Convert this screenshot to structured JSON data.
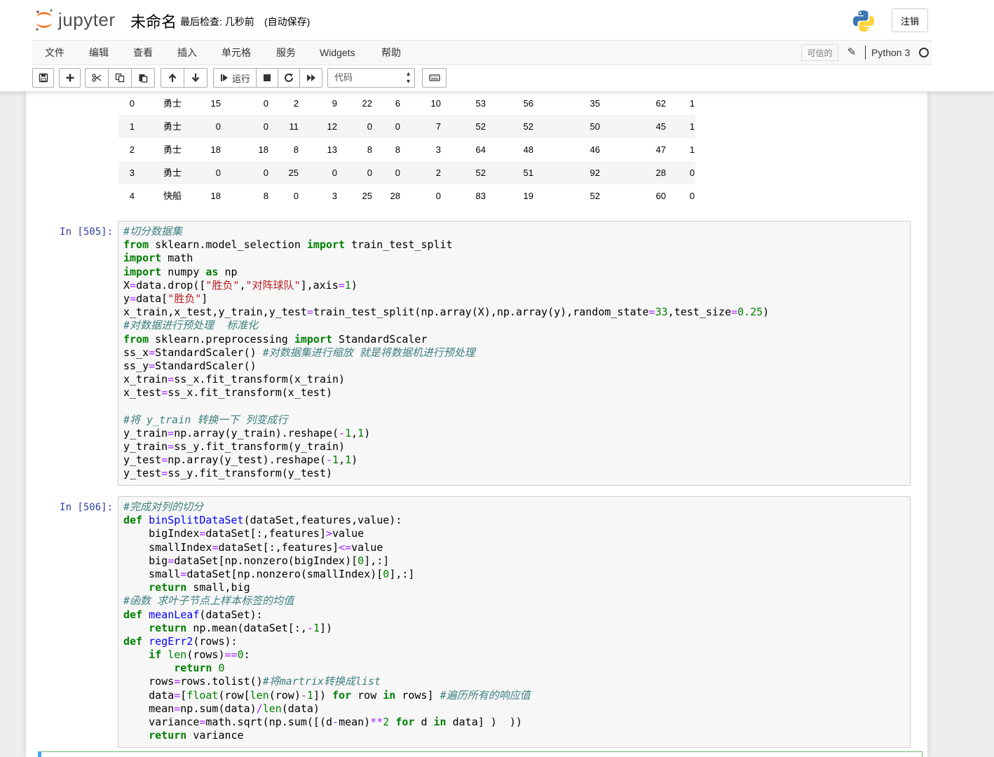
{
  "header": {
    "logo_text": "jupyter",
    "notebook_name": "未命名",
    "checkpoint": "最后检查: 几秒前",
    "autosave": "(自动保存)",
    "logout_label": "注销"
  },
  "menu": {
    "items": [
      "文件",
      "编辑",
      "查看",
      "插入",
      "单元格",
      "服务",
      "Widgets",
      "帮助"
    ],
    "trusted_label": "可信的",
    "kernel_name": "Python 3"
  },
  "toolbar": {
    "run_label": "运行",
    "cell_type": "代码"
  },
  "dataframe": {
    "rows": [
      [
        "0",
        "勇士",
        "15",
        "0",
        "2",
        "9",
        "22",
        "6",
        "10",
        "53",
        "56",
        "35",
        "62",
        "1"
      ],
      [
        "1",
        "勇士",
        "0",
        "0",
        "11",
        "12",
        "0",
        "0",
        "7",
        "52",
        "52",
        "50",
        "45",
        "1"
      ],
      [
        "2",
        "勇士",
        "18",
        "18",
        "8",
        "13",
        "8",
        "8",
        "3",
        "64",
        "48",
        "46",
        "47",
        "1"
      ],
      [
        "3",
        "勇士",
        "0",
        "0",
        "25",
        "0",
        "0",
        "0",
        "2",
        "52",
        "51",
        "92",
        "28",
        "0"
      ],
      [
        "4",
        "快船",
        "18",
        "8",
        "0",
        "3",
        "25",
        "28",
        "0",
        "83",
        "19",
        "52",
        "60",
        "0"
      ]
    ]
  },
  "cells": [
    {
      "prompt": "In [505]:",
      "lines": [
        "#切分数据集",
        "from sklearn.model_selection import train_test_split",
        "import math",
        "import numpy as np",
        "X=data.drop([\"胜负\",\"对阵球队\"],axis=1)",
        "y=data[\"胜负\"]",
        "x_train,x_test,y_train,y_test=train_test_split(np.array(X),np.array(y),random_state=33,test_size=0.25)",
        "#对数据进行预处理  标准化",
        "from sklearn.preprocessing import StandardScaler",
        "ss_x=StandardScaler() #对数据集进行缩放 就是将数据机进行预处理",
        "ss_y=StandardScaler()",
        "x_train=ss_x.fit_transform(x_train)",
        "x_test=ss_x.fit_transform(x_test)",
        "",
        "#将 y_train 转换一下 列变成行",
        "y_train=np.array(y_train).reshape(-1,1)",
        "y_train=ss_y.fit_transform(y_train)",
        "y_test=np.array(y_test).reshape(-1,1)",
        "y_test=ss_y.fit_transform(y_test)"
      ]
    },
    {
      "prompt": "In [506]:",
      "lines": [
        "#完成对列的切分",
        "def binSplitDataSet(dataSet,features,value):",
        "    bigIndex=dataSet[:,features]>value",
        "    smallIndex=dataSet[:,features]<=value",
        "    big=dataSet[np.nonzero(bigIndex)[0],:]",
        "    small=dataSet[np.nonzero(smallIndex)[0],:]",
        "    return small,big",
        "#函数 求叶子节点上样本标签的均值",
        "def meanLeaf(dataSet):",
        "    return np.mean(dataSet[:,-1])",
        "def regErr2(rows):",
        "    if len(rows)==0:",
        "        return 0",
        "    rows=rows.tolist()#将martrix转换成list",
        "    data=[float(row[len(row)-1]) for row in rows] #遍历所有的响应值",
        "    mean=np.sum(data)/len(data)",
        "    variance=math.sqrt(np.sum([(d-mean)**2 for d in data] )  ))",
        "    return variance"
      ]
    }
  ]
}
